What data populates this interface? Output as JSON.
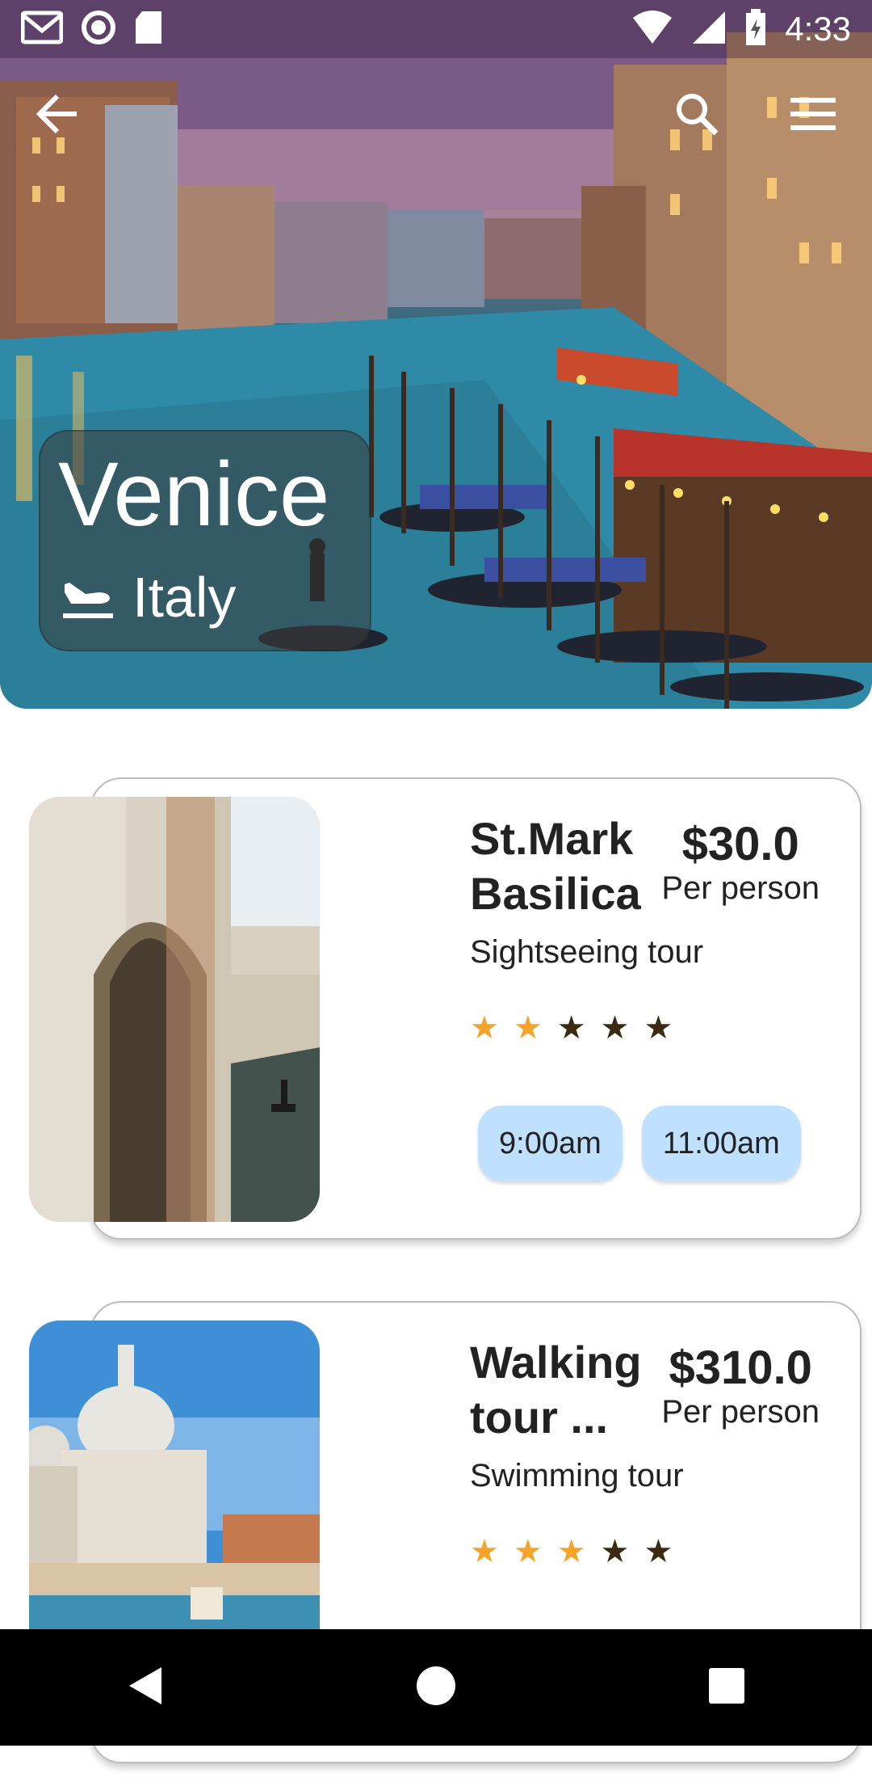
{
  "status_bar": {
    "time": "4:33",
    "icons": [
      "gmail-icon",
      "record-icon",
      "sd-card-icon",
      "wifi-icon",
      "signal-icon",
      "battery-icon"
    ]
  },
  "app_bar": {
    "icons": [
      "back-arrow-icon",
      "search-icon",
      "menu-icon"
    ]
  },
  "destination": {
    "city": "Venice",
    "country": "Italy",
    "country_icon": "flight-land-icon"
  },
  "tours": [
    {
      "name": "St.Mark Basilica",
      "price": "$30.0",
      "price_unit": "Per person",
      "type": "Sightseeing tour",
      "rating": 2,
      "max_rating": 5,
      "times": [
        "9:00am",
        "11:00am"
      ]
    },
    {
      "name": "Walking tour ...",
      "price": "$310.0",
      "price_unit": "Per person",
      "type": "Swimming tour",
      "rating": 3,
      "max_rating": 5,
      "times": []
    }
  ],
  "colors": {
    "star_active": "#f5a32a",
    "star_inactive": "#3a2a10",
    "chip_bg": "#bfe1ff",
    "nav_bg": "#000000"
  },
  "nav_bar": {
    "icons": [
      "back-triangle-icon",
      "home-circle-icon",
      "recents-square-icon"
    ]
  }
}
